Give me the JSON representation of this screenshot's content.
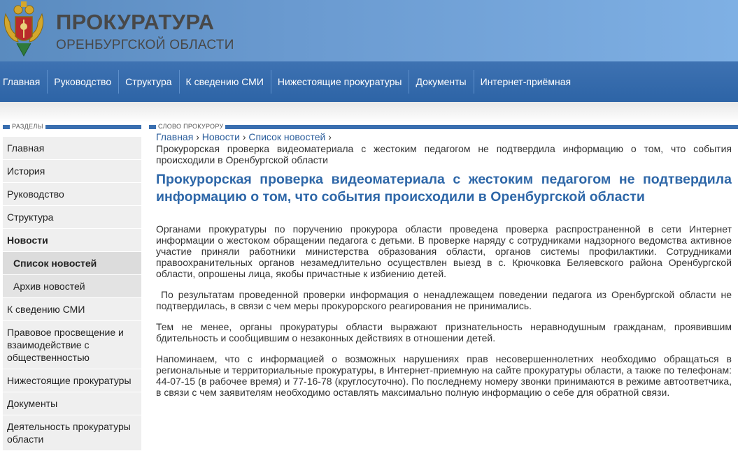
{
  "header": {
    "title": "ПРОКУРАТУРА",
    "subtitle": "ОРЕНБУРГСКОЙ ОБЛАСТИ",
    "emblem_icon": "coat-of-arms-icon"
  },
  "nav": {
    "items": [
      "Главная",
      "Руководство",
      "Структура",
      "К сведению СМИ",
      "Нижестоящие прокуратуры",
      "Документы",
      "Интернет-приёмная"
    ]
  },
  "sidebar": {
    "heading": "РАЗДЕЛЫ",
    "items": [
      "Главная",
      "История",
      "Руководство",
      "Структура",
      "Новости",
      "Список новостей",
      "Архив новостей",
      "К сведению СМИ",
      "Правовое просвещение и взаимодействие с общественностью",
      "Нижестоящие прокуратуры",
      "Документы",
      "Деятельность прокуратуры области"
    ]
  },
  "content": {
    "heading": "СЛОВО ПРОКУРОРУ",
    "breadcrumb": [
      "Главная",
      "Новости",
      "Список новостей"
    ],
    "breadcrumb_sep": "›",
    "crumb_title": "Прокурорская проверка видеоматериала с жестоким педагогом не подтвердила информацию о том, что события происходили в Оренбургской области",
    "article_title": "Прокурорская проверка видеоматериала с жестоким педагогом не подтвердила информацию о том, что события происходили в Оренбургской области",
    "paragraphs": [
      "Органами прокуратуры по поручению прокурора области проведена проверка распространенной в сети Интернет информации о жестоком обращении педагога с детьми. В проверке наряду с сотрудниками надзорного ведомства активное участие приняли работники министерства образования области, органов системы профилактики. Сотрудниками правоохранительных органов незамедлительно осуществлен выезд в с. Крючковка Беляевского района Оренбургской области, опрошены лица, якобы причастные к избиению детей.",
      " По результатам проведенной проверки информация о ненадлежащем поведении педагога из Оренбургской области не подтвердилась, в связи с чем меры прокурорского реагирования не принимались.",
      "Тем не менее, органы прокуратуры области выражают признательность неравнодушным гражданам, проявившим бдительность и сообщившим о незаконных действиях в отношении детей.",
      "Напоминаем, что с информацией о возможных нарушениях прав несовершеннолетних необходимо обращаться в региональные и территориальные прокуратуры, в Интернет-приемную на сайте прокуратуры области, а также по телефонам: 44-07-15 (в рабочее время) и 77-16-78 (круглосуточно). По последнему номеру звонки принимаются в режиме автоответчика, в связи с чем заявителям необходимо оставлять максимально полную информацию о себе для обратной связи."
    ]
  },
  "colors": {
    "header_blue": "#6a9ad0",
    "nav_blue": "#2d64a6",
    "title_blue": "#2e67a8",
    "accent_blue": "#3a6fb0"
  }
}
